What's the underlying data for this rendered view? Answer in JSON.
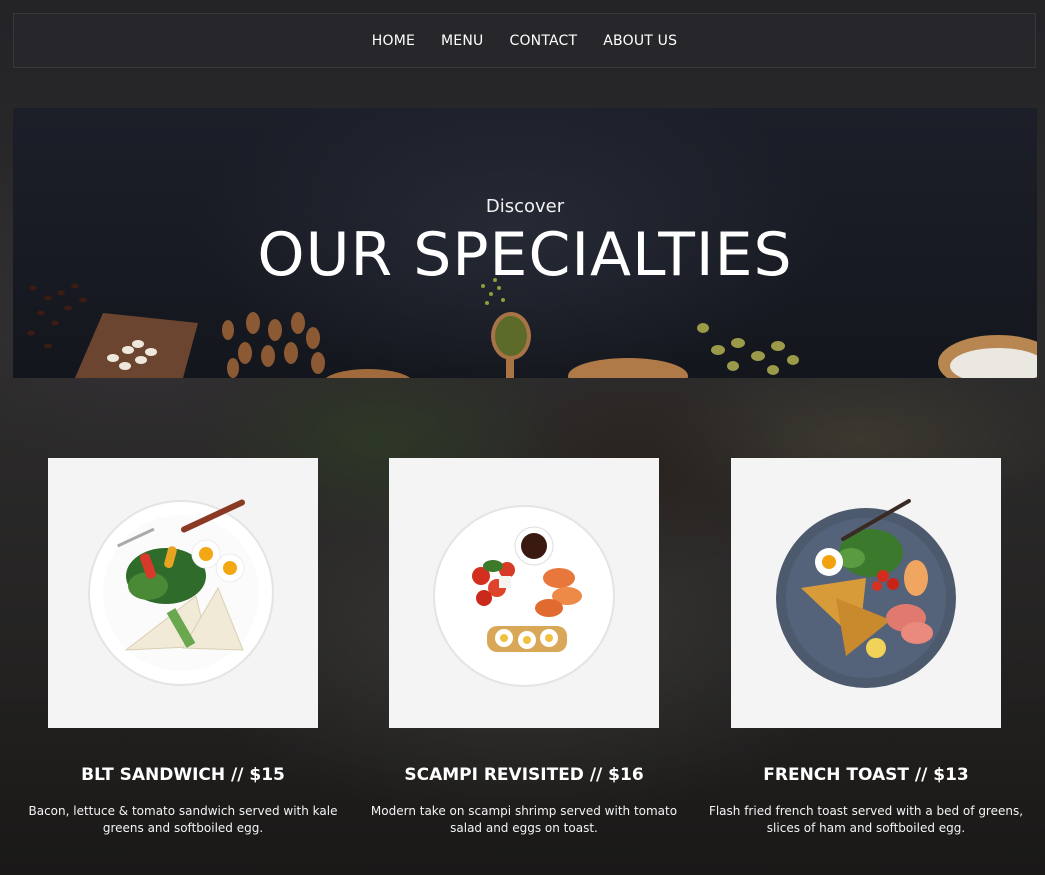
{
  "nav": {
    "items": [
      {
        "label": "HOME"
      },
      {
        "label": "MENU"
      },
      {
        "label": "CONTACT"
      },
      {
        "label": "ABOUT US"
      }
    ]
  },
  "hero": {
    "subtitle": "Discover",
    "title": "OUR SPECIALTIES"
  },
  "specialties": [
    {
      "title": "BLT SANDWICH // $15",
      "description": "Bacon, lettuce & tomato sandwich served with kale greens and softboiled egg.",
      "image": "blt-sandwich-plate"
    },
    {
      "title": "SCAMPI REVISITED // $16",
      "description": "Modern take on scampi shrimp served with tomato salad and eggs on toast.",
      "image": "scampi-plate"
    },
    {
      "title": "FRENCH TOAST // $13",
      "description": "Flash fried french toast served with a bed of greens, slices of ham and softboiled egg.",
      "image": "french-toast-plate"
    }
  ]
}
